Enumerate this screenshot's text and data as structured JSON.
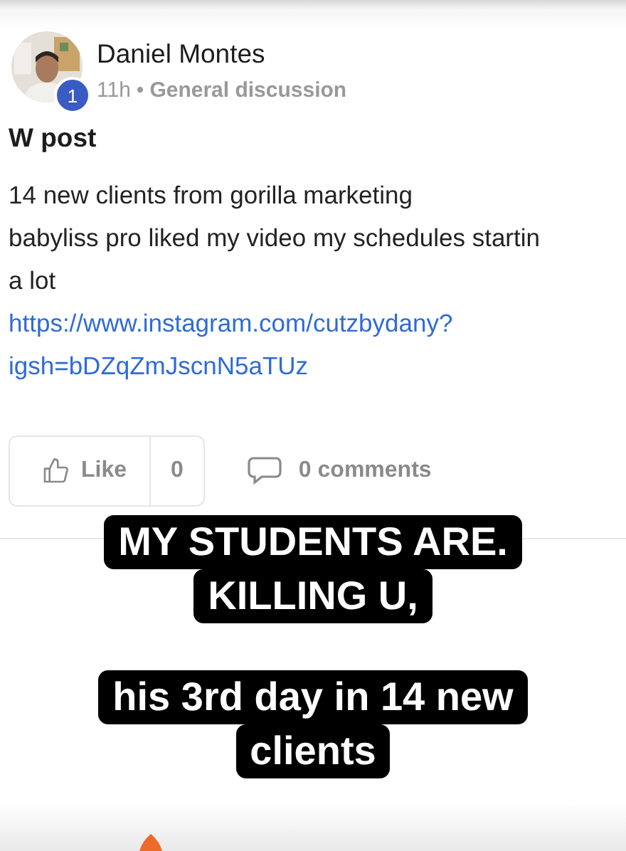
{
  "post": {
    "author": "Daniel Montes",
    "badge": "1",
    "time": "11h",
    "separator": "•",
    "category": "General discussion",
    "title": "W post",
    "body": [
      "14 new clients from gorilla marketing",
      "babyliss pro liked my video my schedules startin",
      "a lot"
    ],
    "link": [
      "https://www.instagram.com/cutzbydany?",
      "igsh=bDZqZmJscnN5aTUz"
    ],
    "like": {
      "label": "Like",
      "count": "0"
    },
    "comments": "0 comments"
  },
  "captions": [
    {
      "lines": [
        "MY STUDENTS ARE.",
        "KILLING U,"
      ]
    },
    {
      "lines": [
        "his 3rd day in 14 new",
        "clients"
      ]
    }
  ]
}
